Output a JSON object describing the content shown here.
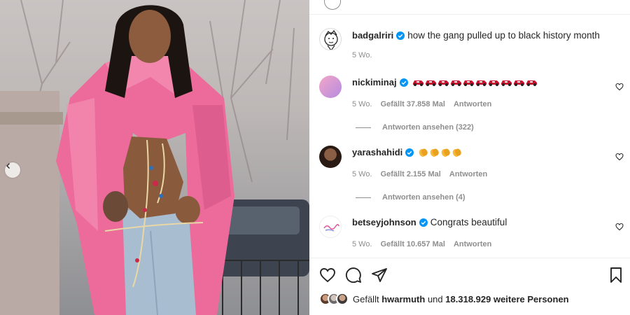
{
  "post": {
    "author": "badgalriri",
    "caption": "how the gang pulled up to black history month",
    "time": "5 Wo."
  },
  "icons": {
    "verified": "verified-badge-icon",
    "heart": "heart-icon",
    "comment": "comment-icon",
    "share": "paper-plane-icon",
    "save": "bookmark-icon",
    "prev": "chevron-left-icon"
  },
  "colors": {
    "verified": "#0095f6",
    "text": "#262626",
    "muted": "#8e8e8e"
  },
  "comments": [
    {
      "user": "nickiminaj",
      "emoji": "🏎",
      "emoji_count": 10,
      "time": "5 Wo.",
      "likes": "Gefällt 37.858 Mal",
      "reply": "Antworten",
      "view_replies": "Antworten ansehen (322)"
    },
    {
      "user": "yarashahidi",
      "emoji": "👏",
      "emoji_count": 4,
      "time": "5 Wo.",
      "likes": "Gefällt 2.155 Mal",
      "reply": "Antworten",
      "view_replies": "Antworten ansehen (4)"
    },
    {
      "user": "betseyjohnson",
      "text": "Congrats beautiful",
      "time": "5 Wo.",
      "likes": "Gefällt 10.657 Mal",
      "reply": "Antworten"
    }
  ],
  "likes_summary": {
    "prefix": "Gefällt",
    "user": "hwarmuth",
    "middle": "und",
    "count": "18.318.929 weitere Personen"
  }
}
